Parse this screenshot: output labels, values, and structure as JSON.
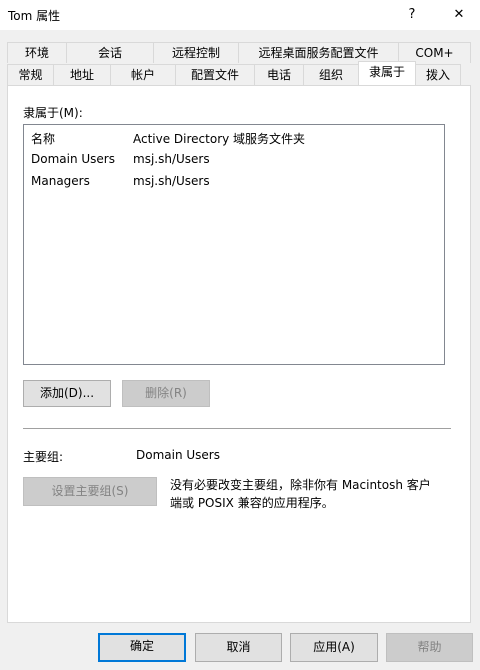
{
  "window": {
    "title": "Tom 属性",
    "help_glyph": "?",
    "close_glyph": "✕"
  },
  "tabs": {
    "row_top": [
      "环境",
      "会话",
      "远程控制",
      "远程桌面服务配置文件",
      "COM+"
    ],
    "row_bottom": [
      "常规",
      "地址",
      "帐户",
      "配置文件",
      "电话",
      "组织",
      "隶属于",
      "拨入"
    ],
    "active": "隶属于"
  },
  "member_of": {
    "label": "隶属于(M):",
    "columns": [
      "名称",
      "Active Directory 域服务文件夹"
    ],
    "rows": [
      {
        "name": "Domain Users",
        "folder": "msj.sh/Users"
      },
      {
        "name": "Managers",
        "folder": "msj.sh/Users"
      }
    ]
  },
  "actions": {
    "add_label": "添加(D)...",
    "remove_label": "删除(R)"
  },
  "primary_group": {
    "label": "主要组:",
    "value": "Domain Users",
    "set_button_label": "设置主要组(S)",
    "note_line1": "没有必要改变主要组，除非你有 Macintosh 客户",
    "note_line2": "端或 POSIX 兼容的应用程序。"
  },
  "footer": {
    "ok_label": "确定",
    "cancel_label": "取消",
    "apply_label": "应用(A)",
    "help_label": "帮助"
  }
}
